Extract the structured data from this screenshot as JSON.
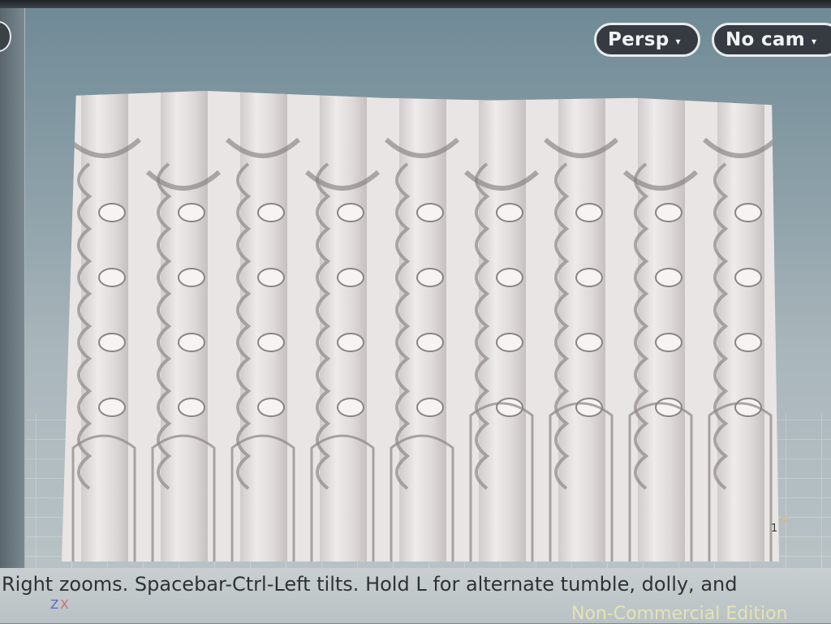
{
  "viewport": {
    "camera_menu": {
      "label": "Persp",
      "caret": "▾"
    },
    "cam_select": {
      "label": "No cam",
      "caret": "▾"
    },
    "corner_label": "1"
  },
  "status": {
    "hint": "Right zooms. Spacebar-Ctrl-Left tilts. Hold L for alternate tumble, dolly, and",
    "axis_z": "Z",
    "axis_x": "X",
    "watermark": "Non-Commercial Edition"
  },
  "colors": {
    "pill_bg": "#353b40",
    "pill_border": "#e9ecee",
    "model": "#e9e5e4",
    "viewport_bg": "#8fa2aa"
  }
}
